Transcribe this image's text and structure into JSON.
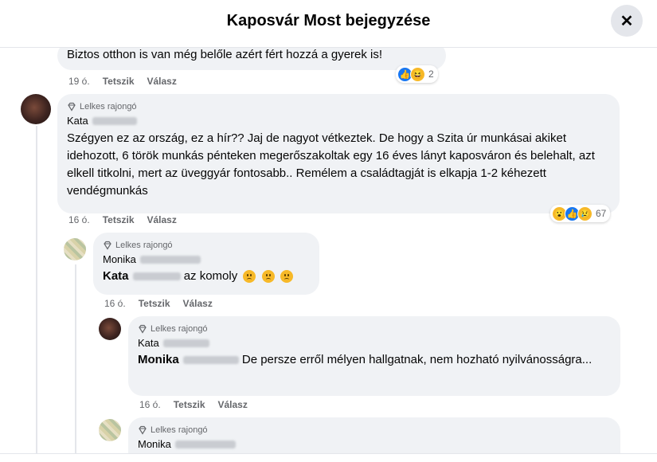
{
  "header": {
    "title": "Kaposvár Most bejegyzése",
    "close_glyph": "✕"
  },
  "badge_label": "Lelkes rajongó",
  "comments": [
    {
      "text": "Biztos otthon is van még belőle azért fért hozzá a gyerek is!",
      "time": "19 ó.",
      "like": "Tetszik",
      "reply": "Válasz",
      "reaction_count": "2"
    },
    {
      "author": "Kata",
      "text": "Szégyen ez az ország, ez a hír?? Jaj de nagyot vétkeztek. De hogy a Szita úr munkásai akiket idehozott, 6 török munkás pénteken megerőszakoltak egy 16 éves lányt kaposváron és belehalt, azt elkell titkolni, mert az üveggyár fontosabb.. Remélem a családtagját is elkapja 1-2 kéhezett vendégmunkás",
      "time": "16 ó.",
      "like": "Tetszik",
      "reply": "Válasz",
      "reaction_count": "67"
    },
    {
      "author": "Monika",
      "mention": "Kata",
      "text": "az komoly",
      "time": "16 ó.",
      "like": "Tetszik",
      "reply": "Válasz"
    },
    {
      "author": "Kata",
      "mention": "Monika",
      "text": "De persze erről mélyen hallgatnak, nem hozható nyilvánosságra...",
      "time": "16 ó.",
      "like": "Tetszik",
      "reply": "Válasz"
    },
    {
      "author": "Monika"
    }
  ]
}
